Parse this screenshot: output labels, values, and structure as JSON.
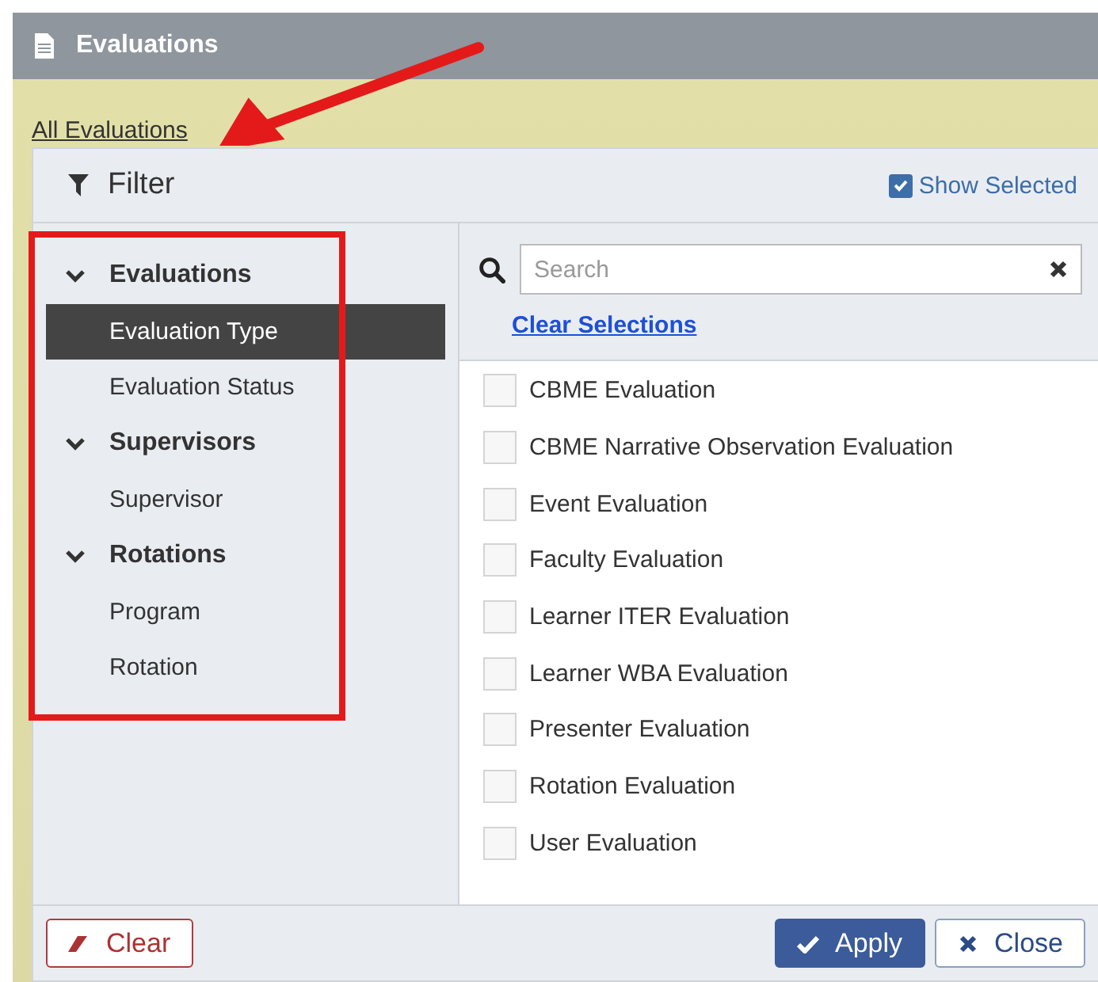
{
  "window": {
    "title": "Evaluations"
  },
  "breadcrumb_link": "All Evaluations",
  "filter": {
    "title": "Filter",
    "show_selected": {
      "label": "Show Selected",
      "checked": true
    }
  },
  "sidebar": {
    "groups": [
      {
        "label": "Evaluations",
        "expanded": true,
        "items": [
          {
            "label": "Evaluation Type",
            "selected": true
          },
          {
            "label": "Evaluation Status",
            "selected": false
          }
        ]
      },
      {
        "label": "Supervisors",
        "expanded": true,
        "items": [
          {
            "label": "Supervisor",
            "selected": false
          }
        ]
      },
      {
        "label": "Rotations",
        "expanded": true,
        "items": [
          {
            "label": "Program",
            "selected": false
          },
          {
            "label": "Rotation",
            "selected": false
          }
        ]
      }
    ]
  },
  "search": {
    "placeholder": "Search"
  },
  "clear_selections": "Clear Selections",
  "options": [
    {
      "label": "CBME Evaluation",
      "checked": false
    },
    {
      "label": "CBME Narrative Observation Evaluation",
      "checked": false
    },
    {
      "label": "Event Evaluation",
      "checked": false
    },
    {
      "label": "Faculty Evaluation",
      "checked": false
    },
    {
      "label": "Learner ITER Evaluation",
      "checked": false
    },
    {
      "label": "Learner WBA Evaluation",
      "checked": false
    },
    {
      "label": "Presenter Evaluation",
      "checked": false
    },
    {
      "label": "Rotation Evaluation",
      "checked": false
    },
    {
      "label": "User Evaluation",
      "checked": false
    }
  ],
  "buttons": [
    {
      "kind": "clear",
      "label": "Clear"
    },
    {
      "kind": "apply",
      "label": "Apply"
    },
    {
      "kind": "close",
      "label": "Close"
    }
  ]
}
